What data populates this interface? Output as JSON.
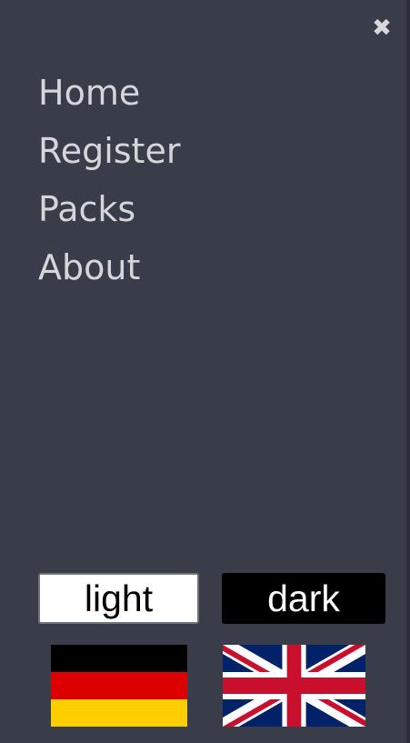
{
  "menu": {
    "close_symbol": "✖",
    "items": [
      {
        "label": "Home"
      },
      {
        "label": "Register"
      },
      {
        "label": "Packs"
      },
      {
        "label": "About"
      }
    ]
  },
  "theme": {
    "light_label": "light",
    "dark_label": "dark"
  },
  "languages": [
    {
      "code": "de",
      "icon": "flag-germany-icon"
    },
    {
      "code": "en",
      "icon": "flag-united-kingdom-icon"
    }
  ],
  "colors": {
    "background": "#393c49",
    "menu_text": "#d6d6da",
    "light_button_bg": "#ffffff",
    "dark_button_bg": "#000000",
    "de_black": "#000000",
    "de_red": "#dd0000",
    "de_gold": "#ffce00",
    "uk_blue": "#012169",
    "uk_red": "#c8102e"
  }
}
